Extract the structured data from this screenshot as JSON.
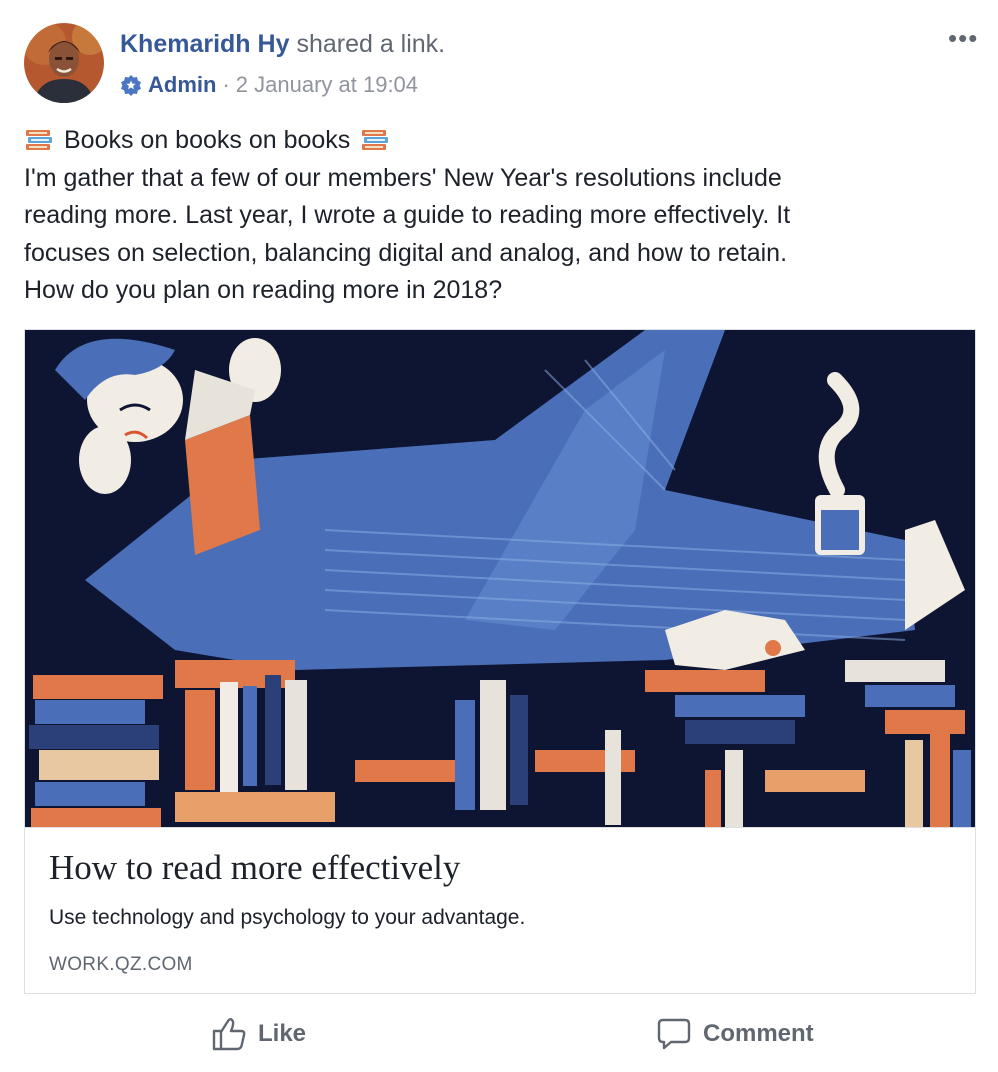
{
  "post": {
    "author": "Khemaridh Hy",
    "action": "shared a link.",
    "role": "Admin",
    "separator": "·",
    "timestamp": "2 January at 19:04",
    "more_label": "•••",
    "heading_text": "Books on books on books",
    "body_lines": [
      "I'm gather that a few of our members' New Year's resolutions include",
      "reading more. Last year, I wrote a guide to reading more effectively. It",
      "focuses on selection, balancing digital and analog, and how to retain.",
      "How do you plan on reading more in 2018?"
    ]
  },
  "link_card": {
    "title": "How to read more effectively",
    "description": "Use technology and psychology to your advantage.",
    "domain": "WORK.QZ.COM"
  },
  "actions": {
    "like_label": "Like",
    "comment_label": "Comment"
  },
  "colors": {
    "link_blue": "#365899",
    "meta_grey": "#90949c",
    "illustration_bg": "#0e1533",
    "illustration_blue": "#4a6fb8",
    "book_orange": "#e0784a"
  },
  "icons": {
    "more": "more-icon",
    "admin_badge": "admin-badge-icon",
    "books": "books-emoji-icon",
    "like": "thumbs-up-icon",
    "comment": "comment-bubble-icon"
  }
}
